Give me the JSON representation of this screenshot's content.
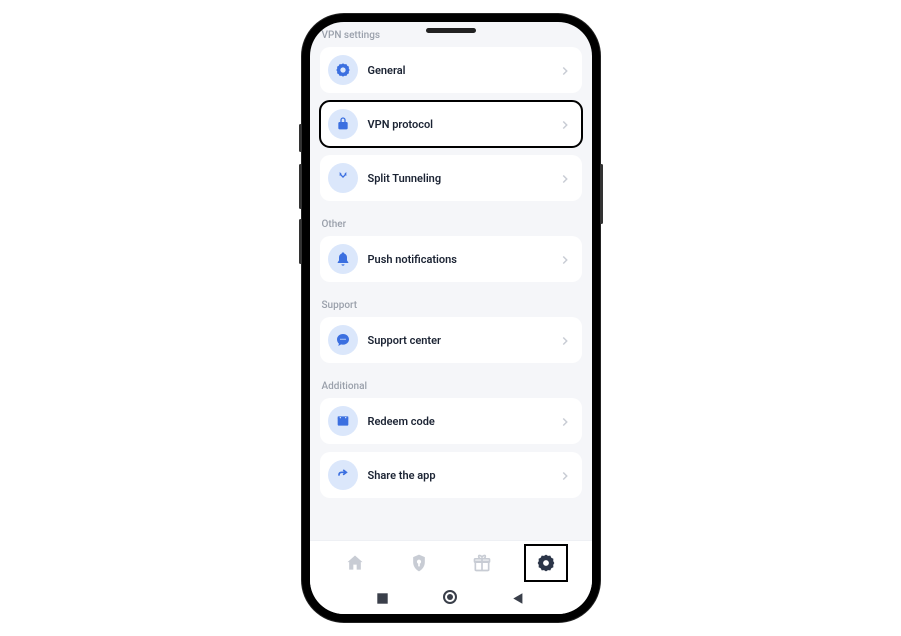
{
  "sections": [
    {
      "label": "VPN settings",
      "items": [
        {
          "label": "General",
          "icon": "gear",
          "highlighted": false
        },
        {
          "label": "VPN protocol",
          "icon": "lock",
          "highlighted": true
        },
        {
          "label": "Split Tunneling",
          "icon": "split",
          "highlighted": false
        }
      ]
    },
    {
      "label": "Other",
      "items": [
        {
          "label": "Push notifications",
          "icon": "bell",
          "highlighted": false
        }
      ]
    },
    {
      "label": "Support",
      "items": [
        {
          "label": "Support center",
          "icon": "chat",
          "highlighted": false
        }
      ]
    },
    {
      "label": "Additional",
      "items": [
        {
          "label": "Redeem code",
          "icon": "ticket",
          "highlighted": false
        },
        {
          "label": "Share the app",
          "icon": "share",
          "highlighted": false
        }
      ]
    }
  ],
  "nav": {
    "items": [
      {
        "name": "home",
        "active": false,
        "highlighted": false
      },
      {
        "name": "shield",
        "active": false,
        "highlighted": false
      },
      {
        "name": "gift",
        "active": false,
        "highlighted": false
      },
      {
        "name": "settings",
        "active": true,
        "highlighted": true
      }
    ]
  },
  "colors": {
    "iconBlue": "#3b6fe0",
    "iconBg": "#dbe7fb",
    "inactive": "#c8ccd4",
    "active": "#2b3548"
  }
}
